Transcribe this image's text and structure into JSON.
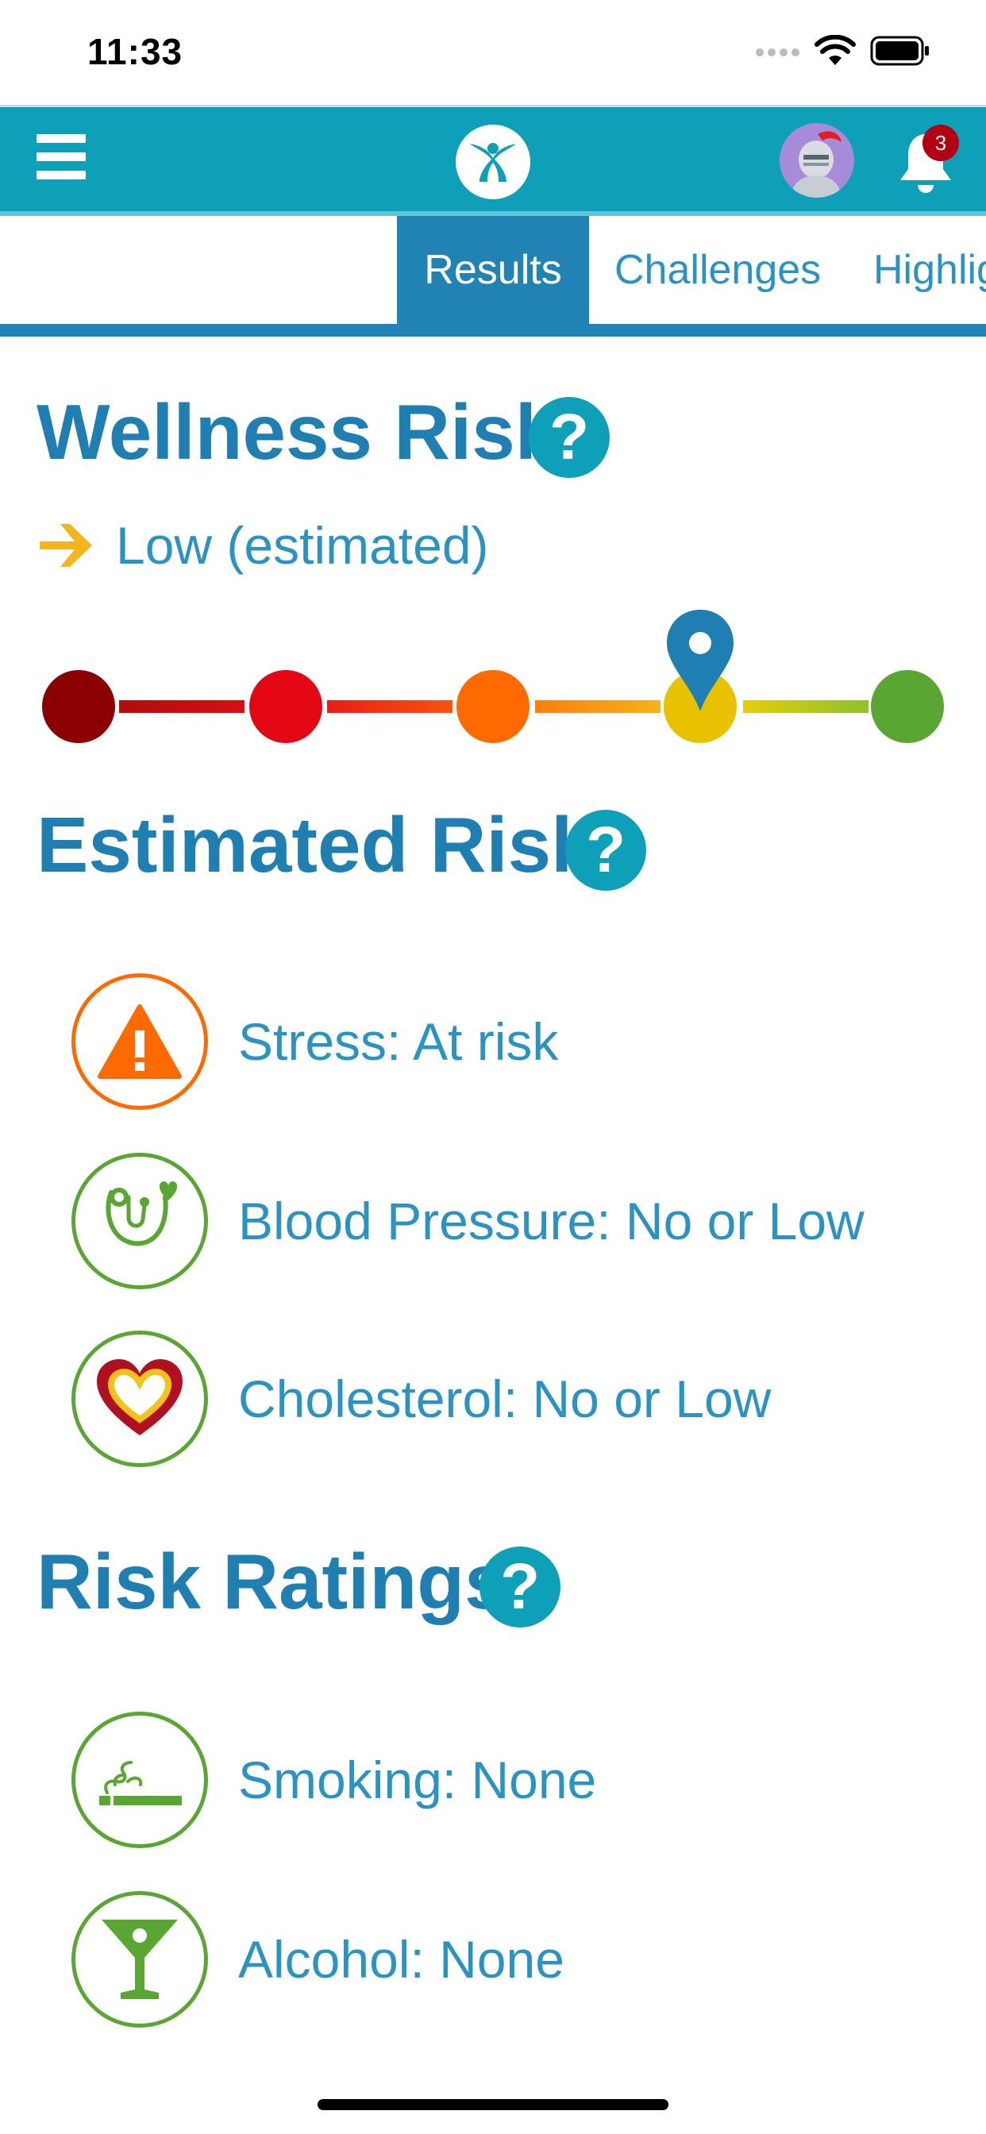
{
  "status_bar": {
    "time": "11:33"
  },
  "header": {
    "notification_count": "3",
    "brand_color": "#0ea0b8"
  },
  "tabs": [
    {
      "label": "Results",
      "active": true
    },
    {
      "label": "Challenges",
      "active": false
    },
    {
      "label": "Highlig",
      "active": false
    }
  ],
  "wellness": {
    "title": "Wellness Risk",
    "help": "?",
    "level": "Low (estimated)",
    "scale_levels": 5,
    "current_level_index": 3,
    "scale_colors": [
      "#8b0000",
      "#e30613",
      "#ff6a00",
      "#e8c200",
      "#5aa632"
    ]
  },
  "estimated": {
    "title": "Estimated Risk",
    "help": "?",
    "items": [
      {
        "label": "Stress: At risk",
        "icon": "warning-icon",
        "status_color": "#ff6a00"
      },
      {
        "label": "Blood Pressure: No or Low",
        "icon": "stethoscope-icon",
        "status_color": "#5aa632"
      },
      {
        "label": "Cholesterol: No or Low",
        "icon": "heart-icon",
        "status_color": "#5aa632"
      }
    ]
  },
  "ratings": {
    "title": "Risk Ratings",
    "help": "?",
    "items": [
      {
        "label": "Smoking: None",
        "icon": "cigarette-icon",
        "status_color": "#5aa632"
      },
      {
        "label": "Alcohol: None",
        "icon": "cocktail-icon",
        "status_color": "#5aa632"
      }
    ]
  }
}
